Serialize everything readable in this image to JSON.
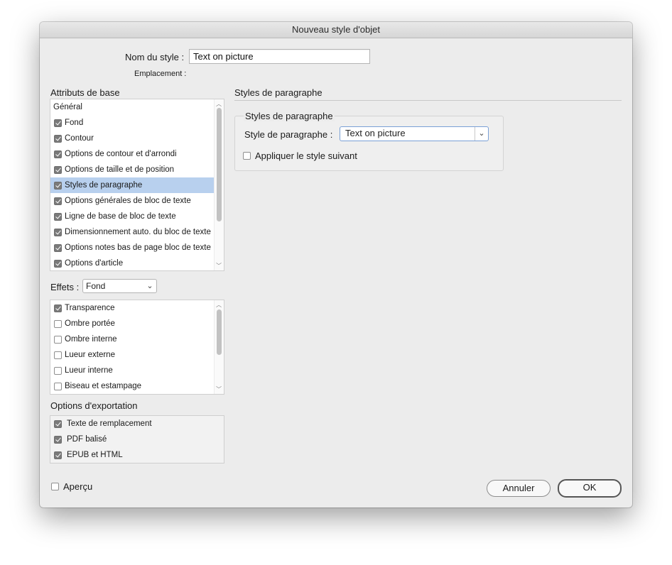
{
  "window": {
    "title": "Nouveau style d'objet"
  },
  "style_name": {
    "label": "Nom du style :",
    "value": "Text on picture"
  },
  "location": {
    "label": "Emplacement :"
  },
  "basic_attributes": {
    "title": "Attributs de base",
    "items": [
      {
        "label": "Général",
        "checkbox": false,
        "checked": false,
        "selected": false
      },
      {
        "label": "Fond",
        "checkbox": true,
        "checked": true,
        "selected": false
      },
      {
        "label": "Contour",
        "checkbox": true,
        "checked": true,
        "selected": false
      },
      {
        "label": "Options de contour et d'arrondi",
        "checkbox": true,
        "checked": true,
        "selected": false
      },
      {
        "label": "Options de taille et de position",
        "checkbox": true,
        "checked": true,
        "selected": false
      },
      {
        "label": "Styles de paragraphe",
        "checkbox": true,
        "checked": true,
        "selected": true
      },
      {
        "label": "Options générales de bloc de texte",
        "checkbox": true,
        "checked": true,
        "selected": false
      },
      {
        "label": "Ligne de base de bloc de texte",
        "checkbox": true,
        "checked": true,
        "selected": false
      },
      {
        "label": "Dimensionnement auto. du bloc de texte",
        "checkbox": true,
        "checked": true,
        "selected": false
      },
      {
        "label": "Options notes bas de page bloc de texte",
        "checkbox": true,
        "checked": true,
        "selected": false
      },
      {
        "label": "Options d'article",
        "checkbox": true,
        "checked": true,
        "selected": false
      }
    ]
  },
  "effects": {
    "label": "Effets :",
    "selected": "Fond",
    "items": [
      {
        "label": "Transparence",
        "checked": true
      },
      {
        "label": "Ombre portée",
        "checked": false
      },
      {
        "label": "Ombre interne",
        "checked": false
      },
      {
        "label": "Lueur externe",
        "checked": false
      },
      {
        "label": "Lueur interne",
        "checked": false
      },
      {
        "label": "Biseau et estampage",
        "checked": false
      }
    ]
  },
  "export_options": {
    "title": "Options d'exportation",
    "items": [
      {
        "label": "Texte de remplacement",
        "checked": true
      },
      {
        "label": "PDF balisé",
        "checked": true
      },
      {
        "label": "EPUB et HTML",
        "checked": true
      }
    ]
  },
  "panel": {
    "title": "Styles de paragraphe",
    "group_title": "Styles de paragraphe",
    "para_style_label": "Style de paragraphe :",
    "para_style_value": "Text on picture",
    "apply_next_label": "Appliquer le style suivant",
    "apply_next_checked": false
  },
  "preview": {
    "label": "Aperçu",
    "checked": false
  },
  "buttons": {
    "cancel": "Annuler",
    "ok": "OK"
  },
  "icons": {
    "chevron": "chevron-down-icon",
    "scroll_up": "scroll-up-arrow-icon",
    "scroll_down": "scroll-down-arrow-icon",
    "checkmark": "checkmark-icon"
  }
}
